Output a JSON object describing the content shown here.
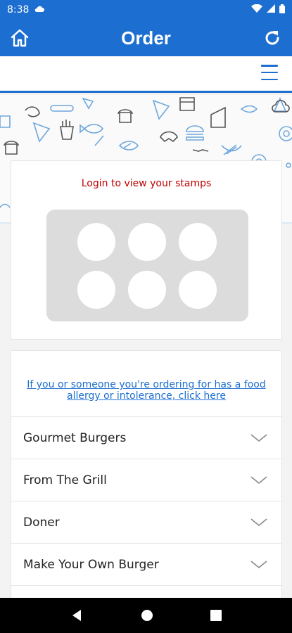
{
  "status_bar": {
    "time": "8:38"
  },
  "app_bar": {
    "title": "Order",
    "home_icon": "home-icon",
    "refresh_icon": "refresh-icon"
  },
  "menu_strip": {
    "hamburger_icon": "hamburger-menu-icon"
  },
  "stamps": {
    "login_text": "Login to view your stamps",
    "count": 6,
    "filled": 0
  },
  "allergy": {
    "link_text": "If you or someone you're ordering for has a food allergy or intolerance, click here"
  },
  "categories": [
    {
      "label": "Gourmet Burgers"
    },
    {
      "label": "From The Grill"
    },
    {
      "label": "Doner"
    },
    {
      "label": "Make Your Own Burger"
    }
  ],
  "colors": {
    "primary": "#1c6fd0",
    "login_text": "#c00000",
    "stamp_board": "#dcdcdc"
  }
}
